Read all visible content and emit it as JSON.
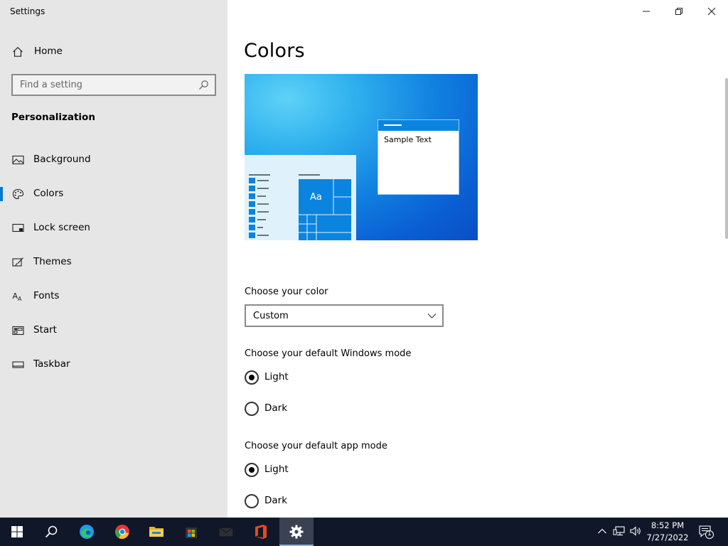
{
  "window": {
    "title": "Settings"
  },
  "sidebar": {
    "home_label": "Home",
    "search_placeholder": "Find a setting",
    "section_title": "Personalization",
    "items": [
      {
        "label": "Background",
        "icon": "picture-icon"
      },
      {
        "label": "Colors",
        "icon": "palette-icon",
        "active": true
      },
      {
        "label": "Lock screen",
        "icon": "lock-screen-icon"
      },
      {
        "label": "Themes",
        "icon": "brush-icon"
      },
      {
        "label": "Fonts",
        "icon": "fonts-icon"
      },
      {
        "label": "Start",
        "icon": "start-icon"
      },
      {
        "label": "Taskbar",
        "icon": "taskbar-icon"
      }
    ]
  },
  "main": {
    "title": "Colors",
    "preview": {
      "sample_text": "Sample Text",
      "tile_text": "Aa"
    },
    "choose_color": {
      "label": "Choose your color",
      "selected": "Custom"
    },
    "windows_mode": {
      "label": "Choose your default Windows mode",
      "options": [
        "Light",
        "Dark"
      ],
      "selected": "Light"
    },
    "app_mode": {
      "label": "Choose your default app mode",
      "options": [
        "Light",
        "Dark"
      ],
      "selected": "Light"
    }
  },
  "taskbar": {
    "time": "8:52 PM",
    "date": "7/27/2022",
    "notifications": "1",
    "apps": [
      "start-icon",
      "search-icon",
      "edge-icon",
      "chrome-icon",
      "file-explorer-icon",
      "store-icon",
      "mail-icon",
      "office-icon",
      "settings-icon"
    ]
  },
  "colors": {
    "accent": "#0078d4",
    "sidebar_bg": "#e6e6e6",
    "taskbar_bg": "#101728"
  }
}
